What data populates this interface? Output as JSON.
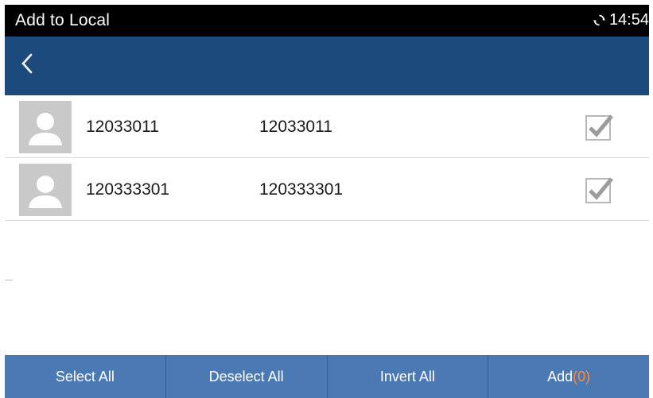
{
  "statusbar": {
    "title": "Add to Local",
    "time": "14:54",
    "sync_icon": "sync-icon"
  },
  "navbar": {
    "back_icon": "chevron-left-icon"
  },
  "contacts": [
    {
      "name": "12033011",
      "number": "12033011",
      "checked": true
    },
    {
      "name": "120333301",
      "number": "120333301",
      "checked": true
    }
  ],
  "bottombar": {
    "select_all": "Select All",
    "deselect_all": "Deselect All",
    "invert_all": "Invert All",
    "add_label": "Add",
    "add_count": "(0)"
  },
  "colors": {
    "navbar": "#1c4a7c",
    "bottombar": "#4b79b3",
    "count_accent": "#ff8a3d"
  }
}
